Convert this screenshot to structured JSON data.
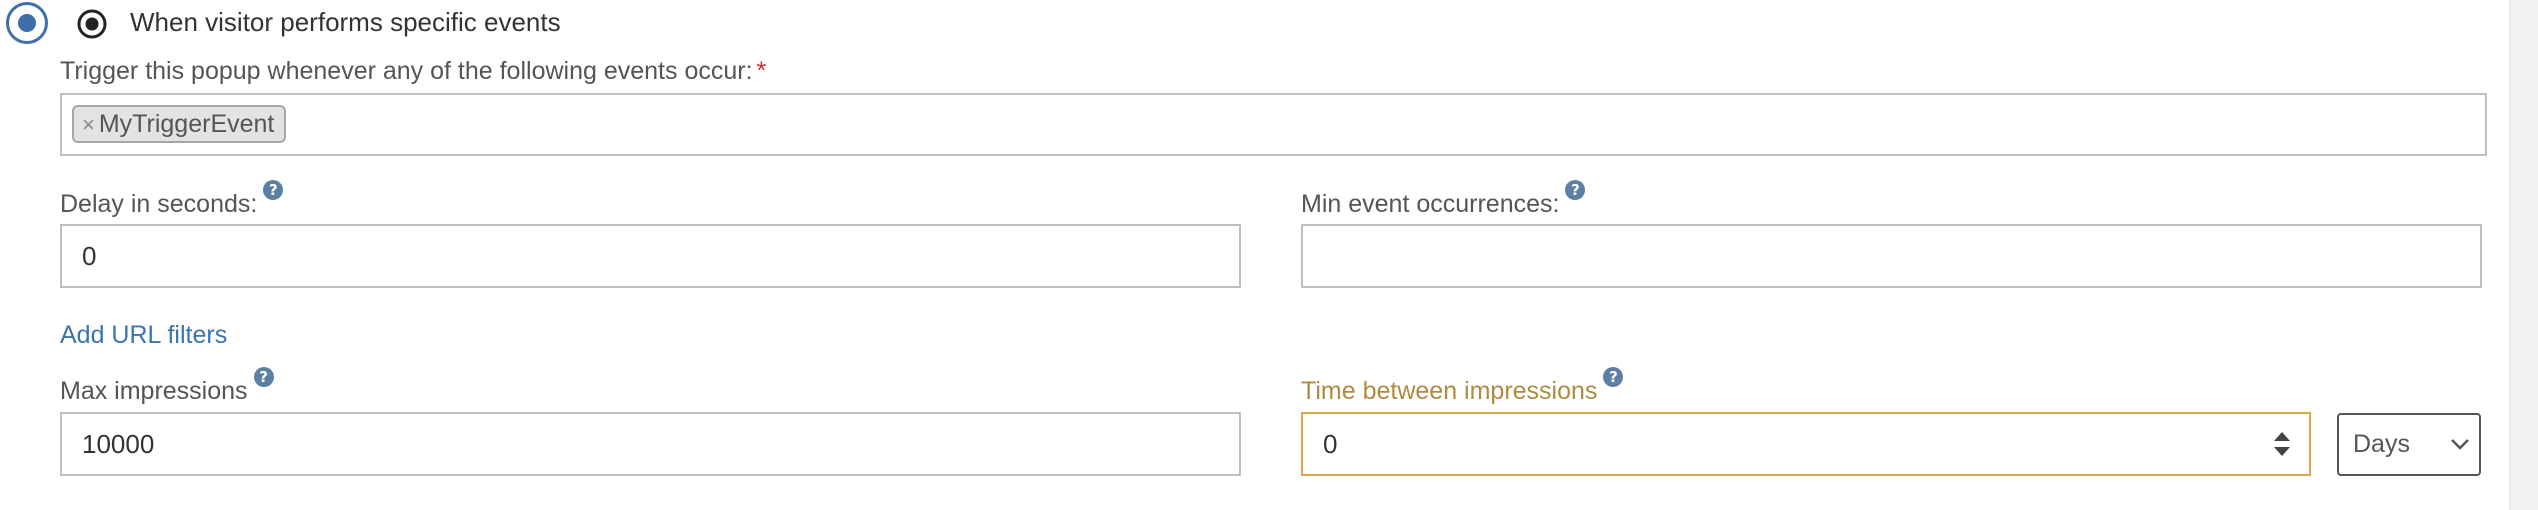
{
  "trigger_option": {
    "label": "When visitor performs specific events",
    "selected": true
  },
  "events_field": {
    "label": "Trigger this popup whenever any of the following events occur:",
    "required_marker": "*",
    "tags": [
      {
        "remove_symbol": "×",
        "label": "MyTriggerEvent"
      }
    ]
  },
  "delay_field": {
    "label": "Delay in seconds:",
    "help_icon": "?",
    "value": "0"
  },
  "min_occurrences_field": {
    "label": "Min event occurrences:",
    "help_icon": "?",
    "value": ""
  },
  "url_filters_link": {
    "label": "Add URL filters"
  },
  "max_impressions_field": {
    "label": "Max impressions",
    "help_icon": "?",
    "value": "10000"
  },
  "time_between_field": {
    "label": "Time between impressions",
    "help_icon": "?",
    "value": "0",
    "unit_selected": "Days"
  },
  "colors": {
    "accent": "#3f6fa8",
    "link": "#3c74b1",
    "warning": "#b08a3e",
    "required": "#d9262e"
  }
}
